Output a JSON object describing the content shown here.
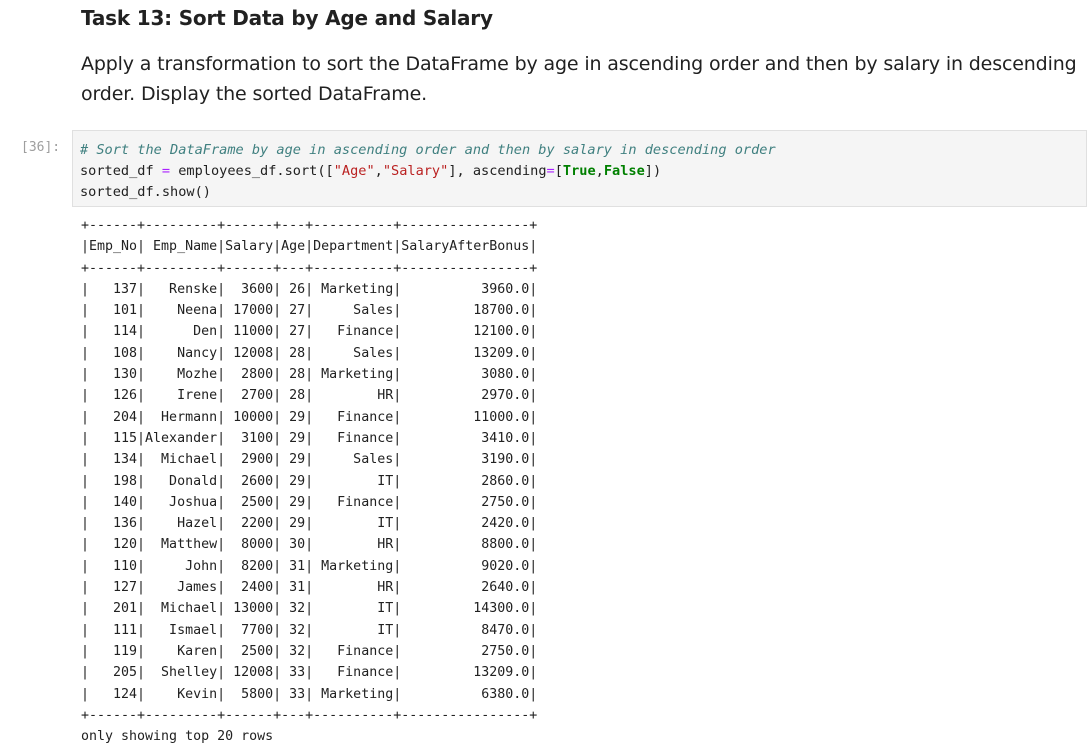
{
  "markdown": {
    "heading": "Task 13: Sort Data by Age and Salary",
    "paragraph": "Apply a transformation to sort the DataFrame by age in ascending order and then by salary in descending order. Display the sorted DataFrame."
  },
  "cell": {
    "prompt": "[36]:",
    "code_lines": [
      "# Sort the DataFrame by age in ascending order and then by salary in descending order",
      "sorted_df = employees_df.sort([\"Age\",\"Salary\"], ascending=[True,False])",
      "sorted_df.show()"
    ]
  },
  "output": {
    "columns": [
      "Emp_No",
      "Emp_Name",
      "Salary",
      "Age",
      "Department",
      "SalaryAfterBonus"
    ],
    "rows": [
      [
        "137",
        "Renske",
        "3600",
        "26",
        "Marketing",
        "3960.0"
      ],
      [
        "101",
        "Neena",
        "17000",
        "27",
        "Sales",
        "18700.0"
      ],
      [
        "114",
        "Den",
        "11000",
        "27",
        "Finance",
        "12100.0"
      ],
      [
        "108",
        "Nancy",
        "12008",
        "28",
        "Sales",
        "13209.0"
      ],
      [
        "130",
        "Mozhe",
        "2800",
        "28",
        "Marketing",
        "3080.0"
      ],
      [
        "126",
        "Irene",
        "2700",
        "28",
        "HR",
        "2970.0"
      ],
      [
        "204",
        "Hermann",
        "10000",
        "29",
        "Finance",
        "11000.0"
      ],
      [
        "115",
        "Alexander",
        "3100",
        "29",
        "Finance",
        "3410.0"
      ],
      [
        "134",
        "Michael",
        "2900",
        "29",
        "Sales",
        "3190.0"
      ],
      [
        "198",
        "Donald",
        "2600",
        "29",
        "IT",
        "2860.0"
      ],
      [
        "140",
        "Joshua",
        "2500",
        "29",
        "Finance",
        "2750.0"
      ],
      [
        "136",
        "Hazel",
        "2200",
        "29",
        "IT",
        "2420.0"
      ],
      [
        "120",
        "Matthew",
        "8000",
        "30",
        "HR",
        "8800.0"
      ],
      [
        "110",
        "John",
        "8200",
        "31",
        "Marketing",
        "9020.0"
      ],
      [
        "127",
        "James",
        "2400",
        "31",
        "HR",
        "2640.0"
      ],
      [
        "201",
        "Michael",
        "13000",
        "32",
        "IT",
        "14300.0"
      ],
      [
        "111",
        "Ismael",
        "7700",
        "32",
        "IT",
        "8470.0"
      ],
      [
        "119",
        "Karen",
        "2500",
        "32",
        "Finance",
        "2750.0"
      ],
      [
        "205",
        "Shelley",
        "12008",
        "33",
        "Finance",
        "13209.0"
      ],
      [
        "124",
        "Kevin",
        "5800",
        "33",
        "Marketing",
        "6380.0"
      ]
    ],
    "footer": "only showing top 20 rows"
  }
}
